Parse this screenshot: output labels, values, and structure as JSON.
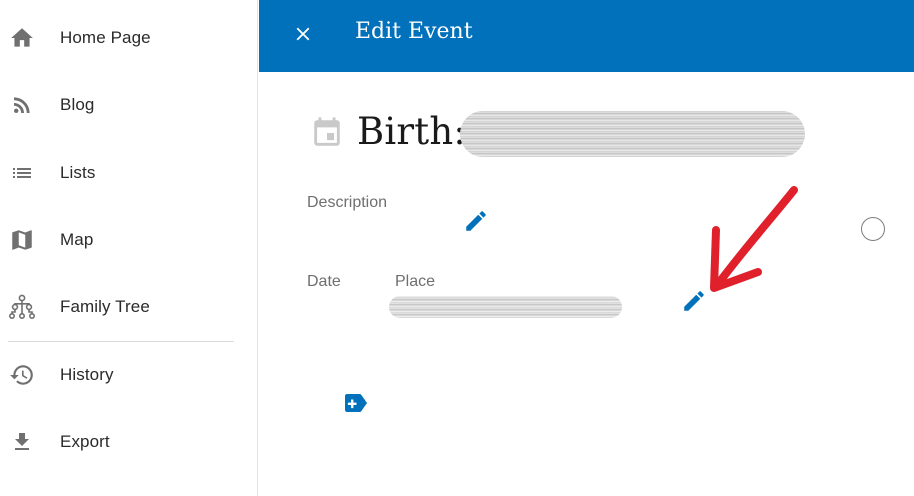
{
  "sidebar": {
    "items": [
      {
        "label": "Home Page",
        "icon": "home-icon"
      },
      {
        "label": "Blog",
        "icon": "rss-icon"
      },
      {
        "label": "Lists",
        "icon": "list-icon"
      },
      {
        "label": "Map",
        "icon": "map-icon"
      },
      {
        "label": "Family Tree",
        "icon": "family-tree-icon"
      },
      {
        "label": "History",
        "icon": "history-icon"
      },
      {
        "label": "Export",
        "icon": "download-icon"
      }
    ]
  },
  "header": {
    "title": "Edit Event",
    "close_icon": "close-icon",
    "background_color": "#0271bb"
  },
  "event": {
    "title": "Birth:",
    "title_icon": "calendar-icon",
    "description_label": "Description",
    "date_label": "Date",
    "place_label": "Place"
  },
  "colors": {
    "accent": "#0271bb",
    "annotation_arrow": "#e0202a"
  }
}
